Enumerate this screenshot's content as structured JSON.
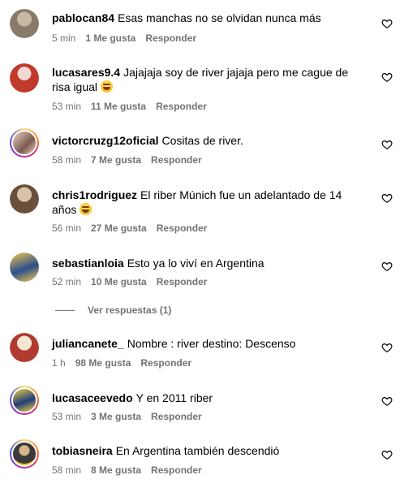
{
  "comments": [
    {
      "username": "pablocan84",
      "text": "Esas manchas no se olvidan nunca más",
      "time": "5 min",
      "likes": "1 Me gusta",
      "reply": "Responder",
      "avatar_colors": [
        "#8a7a6a",
        "#c9b8a3"
      ]
    },
    {
      "username": "lucasares9.4",
      "text": "Jajajaja soy de river jajaja pero me cague de risa igual",
      "time": "53 min",
      "likes": "11 Me gusta",
      "reply": "Responder",
      "avatar_colors": [
        "#c0392b",
        "#f2d7d5"
      ]
    },
    {
      "username": "victorcruzg12oficial",
      "text": "Cositas de river.",
      "time": "58 min",
      "likes": "7 Me gusta",
      "reply": "Responder",
      "avatar_colors": [
        "#7d5a50",
        "#e8d5c4"
      ]
    },
    {
      "username": "chris1rodriguez",
      "text": "El riber Múnich fue un adelantado de 14 años",
      "time": "56 min",
      "likes": "27 Me gusta",
      "reply": "Responder",
      "avatar_colors": [
        "#6b4f3a",
        "#d9c3a8"
      ]
    },
    {
      "username": "sebastianloia",
      "text": "Esto ya lo viví en Argentina",
      "time": "52 min",
      "likes": "10 Me gusta",
      "reply": "Responder",
      "avatar_colors": [
        "#2c4f8c",
        "#f2c94c"
      ]
    },
    {
      "username": "juliancanete_",
      "text": "Nombre : river destino: Descenso",
      "time": "1 h",
      "likes": "98 Me gusta",
      "reply": "Responder",
      "avatar_colors": [
        "#b03a2e",
        "#f5e6d3"
      ]
    },
    {
      "username": "lucasaceevedo",
      "text": "Y en 2011 riber",
      "time": "53 min",
      "likes": "3 Me gusta",
      "reply": "Responder",
      "avatar_colors": [
        "#1f3d7a",
        "#f4d03f"
      ]
    },
    {
      "username": "tobiasneira",
      "text": "En Argentina también descendió",
      "time": "58 min",
      "likes": "8 Me gusta",
      "reply": "Responder",
      "avatar_colors": [
        "#3b3b3b",
        "#f1c40f"
      ]
    }
  ],
  "view_replies": "Ver respuestas (1)",
  "colors": {
    "meta_text": "#737373",
    "story_ring": "#d62976"
  }
}
